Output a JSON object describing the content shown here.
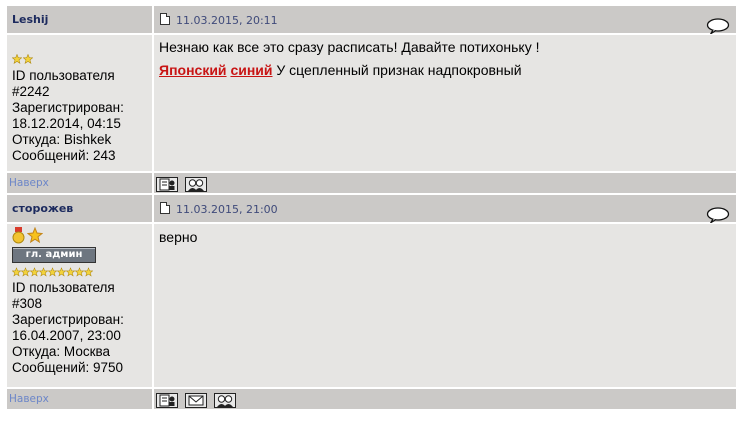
{
  "posts": [
    {
      "author": "Leshij",
      "date": "11.03.2015, 20:11",
      "stars": 2,
      "rank_label": "",
      "user_id_label": "ID пользователя",
      "user_id": "#2242",
      "registered_label": "Зарегистрирован:",
      "registered": "18.12.2014, 04:15",
      "from": "Откуда: Bishkek",
      "messages": "Сообщений: 243",
      "body_line1": "Незнаю как все это сразу расписать! Давайте потихоньку !",
      "body_red1": "Японский",
      "body_red2": "синий",
      "body_rest": " У сцепленный признак надпокровный",
      "top_link": "Наверх"
    },
    {
      "author": "сторожев",
      "date": "11.03.2015, 21:00",
      "stars": 9,
      "rank_label": "гл. админ",
      "user_id_label": "ID пользователя",
      "user_id": "#308",
      "registered_label": "Зарегистрирован:",
      "registered": "16.04.2007, 23:00",
      "from": "Откуда: Москва",
      "messages": "Сообщений: 9750",
      "body_line1": "верно",
      "top_link": "Наверх"
    }
  ],
  "icons": {
    "doc": "document-icon",
    "quote": "quote-bubble-icon",
    "profile": "profile-icon",
    "pm": "envelope-icon",
    "friends": "users-icon",
    "star": "star-icon",
    "medal": "medal-icon"
  },
  "colors": {
    "header_bg": "#cbc9c7",
    "body_bg": "#e6e5e3",
    "author": "#1c2a5e",
    "link": "#6c86c8",
    "red_link": "#c81414"
  }
}
